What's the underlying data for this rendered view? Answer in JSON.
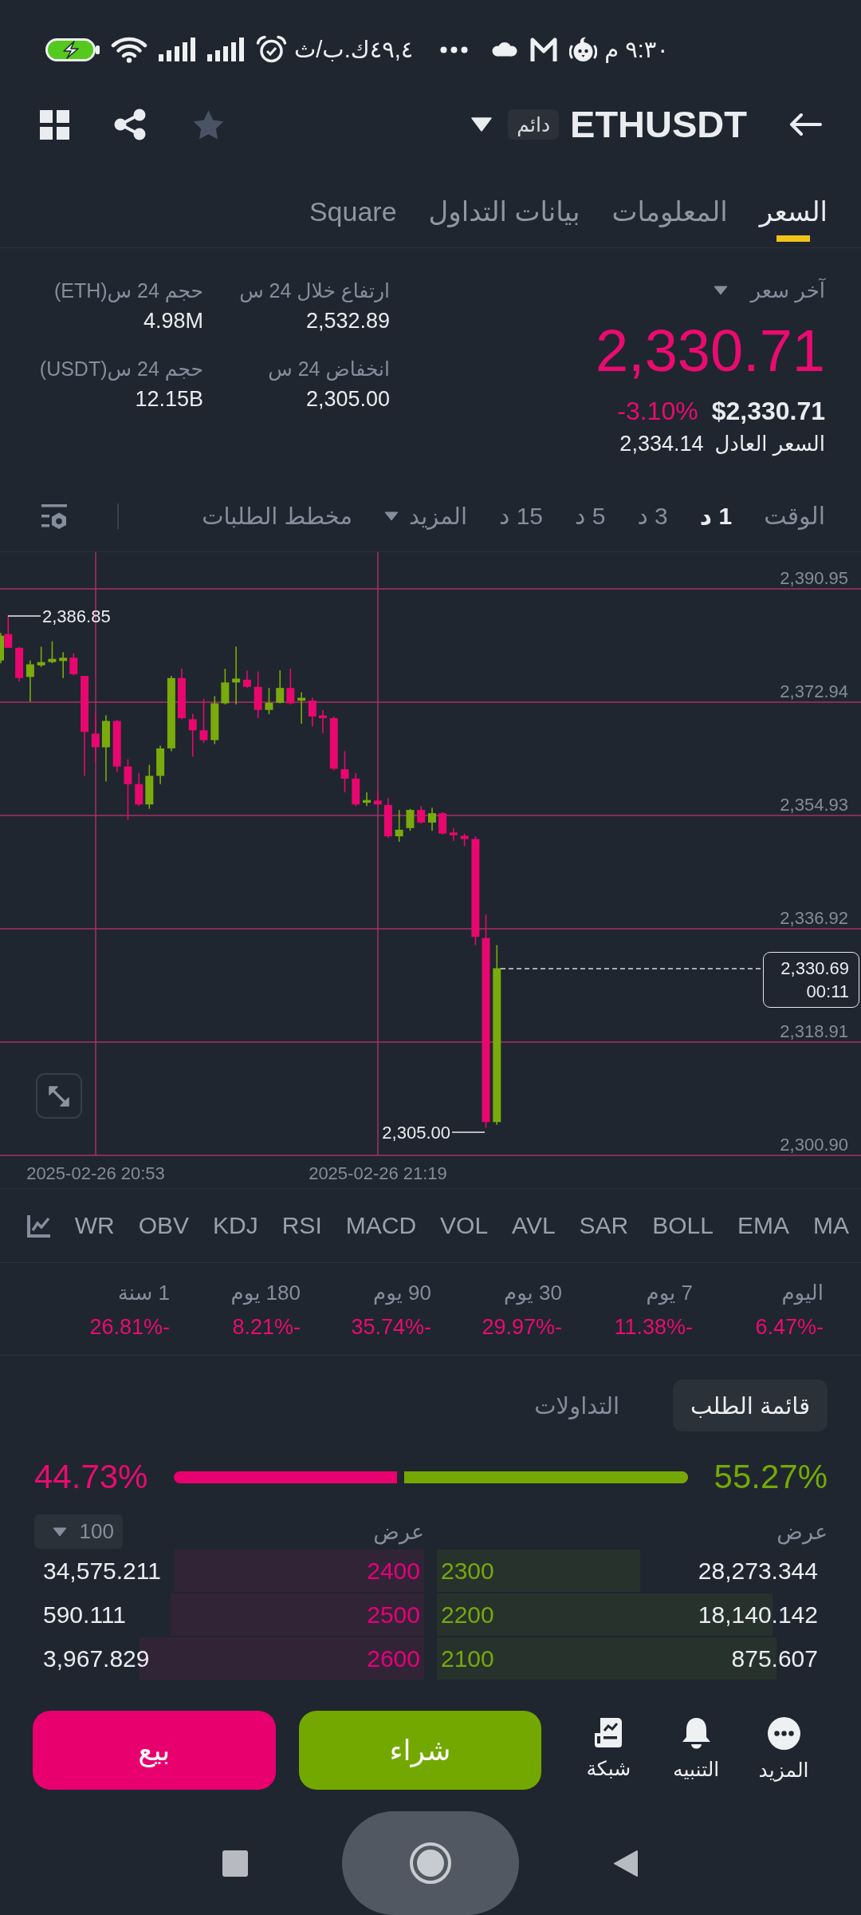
{
  "status_bar": {
    "time": "٩:٣٠ م",
    "net_speed": "٤٩,٤ك.ب/ث"
  },
  "header": {
    "symbol": "ETHUSDT",
    "badge": "دائم",
    "favorite": false
  },
  "tabs": [
    {
      "label": "السعر",
      "selected": true
    },
    {
      "label": "المعلومات",
      "selected": false
    },
    {
      "label": "بيانات التداول",
      "selected": false
    },
    {
      "label": "Square",
      "selected": false
    }
  ],
  "price": {
    "label": "آخر سعر",
    "last": "2,330.71",
    "usd": "$2,330.71",
    "change": "-3.10%",
    "fair_label": "السعر العادل",
    "fair_value": "2,334.14"
  },
  "stats": [
    {
      "label": "ارتفاع خلال 24 س",
      "value": "2,532.89"
    },
    {
      "label": "حجم 24 س(ETH)",
      "value": "4.98M"
    },
    {
      "label": "انخفاض 24 س",
      "value": "2,305.00"
    },
    {
      "label": "حجم 24 س(USDT)",
      "value": "12.15B"
    }
  ],
  "intervals": {
    "label": "الوقت",
    "options": [
      {
        "label": "1 د",
        "selected": true
      },
      {
        "label": "3 د",
        "selected": false
      },
      {
        "label": "5 د",
        "selected": false
      },
      {
        "label": "15 د",
        "selected": false
      }
    ],
    "more": "المزيد",
    "depth_chart": "مخطط الطلبات"
  },
  "chart": {
    "price_labels": [
      "2,390.95",
      "2,372.94",
      "2,354.93",
      "2,336.92",
      "2,318.91",
      "2,300.90"
    ],
    "time_labels": [
      "2025-02-26 21:19",
      "2025-02-26 20:53"
    ],
    "high_marker": "2,386.85",
    "low_marker": "2,305.00",
    "last_price": "2,330.69",
    "countdown": "00:11"
  },
  "indicators": {
    "main": [
      "MA",
      "EMA",
      "BOLL",
      "SAR",
      "AVL"
    ],
    "sub": [
      "VOL",
      "MACD",
      "RSI",
      "KDJ",
      "OBV",
      "WR"
    ]
  },
  "performance": [
    {
      "period": "اليوم",
      "change": "-6.47%"
    },
    {
      "period": "7 يوم",
      "change": "-11.38%"
    },
    {
      "period": "30 يوم",
      "change": "-29.97%"
    },
    {
      "period": "90 يوم",
      "change": "-35.74%"
    },
    {
      "period": "180 يوم",
      "change": "-8.21%"
    },
    {
      "period": "1 سنة",
      "change": "-26.81%"
    }
  ],
  "order_book": {
    "tabs": [
      {
        "label": "قائمة الطلب",
        "selected": true
      },
      {
        "label": "التداولات",
        "selected": false
      }
    ],
    "buy_ratio": "55.27%",
    "sell_ratio": "44.73%",
    "ratio_bar": {
      "level": 0.5527
    },
    "bid_header": "عرض",
    "ask_header": "عرض",
    "precision": "100",
    "rows": [
      {
        "bid": {
          "amount": "28,273.344",
          "price": "2300",
          "level": 0.52
        },
        "ask": {
          "price": "2400",
          "amount": "34,575.211",
          "level": 0.64
        }
      },
      {
        "bid": {
          "amount": "18,140.142",
          "price": "2200",
          "level": 0.86
        },
        "ask": {
          "price": "2500",
          "amount": "590.111",
          "level": 0.65
        }
      },
      {
        "bid": {
          "amount": "875.607",
          "price": "2100",
          "level": 0.87
        },
        "ask": {
          "price": "2600",
          "amount": "3,967.829",
          "level": 0.73
        }
      }
    ]
  },
  "toolbar": {
    "tools": [
      {
        "kind": "more",
        "label": "المزيد"
      },
      {
        "kind": "alert",
        "label": "التنبيه"
      },
      {
        "kind": "feed",
        "label": "شبكة"
      }
    ],
    "buy": "شراء",
    "sell": "بيع"
  }
}
